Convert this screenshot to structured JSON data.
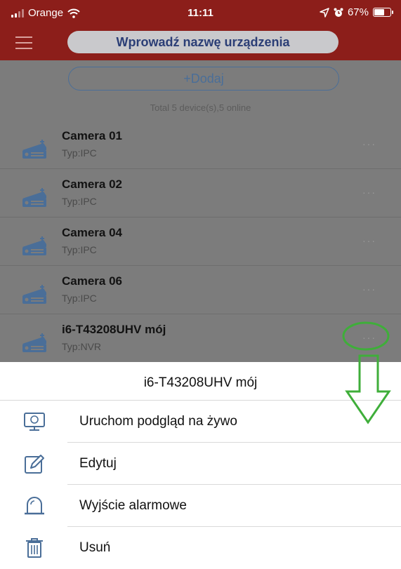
{
  "status_bar": {
    "carrier": "Orange",
    "time": "11:11",
    "battery": "67%",
    "battery_level": 0.67
  },
  "header": {
    "search_placeholder": "Wprowadź nazwę urządzenia"
  },
  "toolbar": {
    "add_label": "+Dodaj",
    "total_text": "Total 5 device(s),5 online"
  },
  "devices": [
    {
      "name": "Camera 01",
      "type": "Typ:IPC"
    },
    {
      "name": "Camera 02",
      "type": "Typ:IPC"
    },
    {
      "name": "Camera 04",
      "type": "Typ:IPC"
    },
    {
      "name": "Camera 06",
      "type": "Typ:IPC"
    },
    {
      "name": "i6-T43208UHV mój",
      "type": "Typ:NVR"
    }
  ],
  "more_label": "···",
  "action_sheet": {
    "title": "i6-T43208UHV mój",
    "actions": [
      {
        "label": "Uruchom podgląd na żywo",
        "icon": "monitor-icon"
      },
      {
        "label": "Edytuj",
        "icon": "edit-icon"
      },
      {
        "label": "Wyjście alarmowe",
        "icon": "alarm-light-icon"
      },
      {
        "label": "Usuń",
        "icon": "trash-icon"
      }
    ]
  },
  "colors": {
    "header_red": "#8c1e1a",
    "accent_blue": "#4a6e98",
    "annotation_green": "#3fae3a"
  }
}
